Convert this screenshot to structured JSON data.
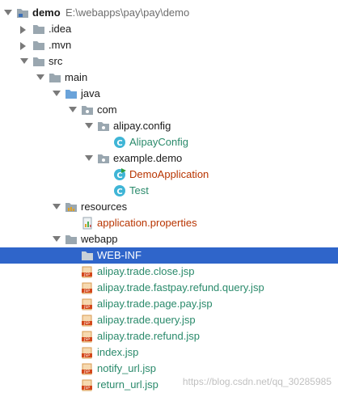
{
  "tree": [
    {
      "name": "demo",
      "path": "E:\\webapps\\pay\\pay\\demo",
      "level": 0,
      "kind": "module",
      "expanded": true,
      "bold": true
    },
    {
      "name": ".idea",
      "level": 1,
      "kind": "folder",
      "expanded": false
    },
    {
      "name": ".mvn",
      "level": 1,
      "kind": "folder",
      "expanded": false
    },
    {
      "name": "src",
      "level": 1,
      "kind": "folder",
      "expanded": true
    },
    {
      "name": "main",
      "level": 2,
      "kind": "folder",
      "expanded": true
    },
    {
      "name": "java",
      "level": 3,
      "kind": "source-folder",
      "expanded": true
    },
    {
      "name": "com",
      "level": 4,
      "kind": "package",
      "expanded": true
    },
    {
      "name": "alipay.config",
      "level": 5,
      "kind": "package",
      "expanded": true
    },
    {
      "name": "AlipayConfig",
      "level": 6,
      "kind": "class",
      "style": "link"
    },
    {
      "name": "example.demo",
      "level": 5,
      "kind": "package",
      "expanded": true
    },
    {
      "name": "DemoApplication",
      "level": 6,
      "kind": "class-run",
      "style": "red"
    },
    {
      "name": "Test",
      "level": 6,
      "kind": "class",
      "style": "link"
    },
    {
      "name": "resources",
      "level": 3,
      "kind": "resources",
      "expanded": true
    },
    {
      "name": "application.properties",
      "level": 4,
      "kind": "properties",
      "style": "red"
    },
    {
      "name": "webapp",
      "level": 3,
      "kind": "folder",
      "expanded": true
    },
    {
      "name": "WEB-INF",
      "level": 4,
      "kind": "folder-web",
      "selected": true
    },
    {
      "name": "alipay.trade.close.jsp",
      "level": 4,
      "kind": "jsp",
      "style": "link"
    },
    {
      "name": "alipay.trade.fastpay.refund.query.jsp",
      "level": 4,
      "kind": "jsp",
      "style": "link"
    },
    {
      "name": "alipay.trade.page.pay.jsp",
      "level": 4,
      "kind": "jsp",
      "style": "link"
    },
    {
      "name": "alipay.trade.query.jsp",
      "level": 4,
      "kind": "jsp",
      "style": "link"
    },
    {
      "name": "alipay.trade.refund.jsp",
      "level": 4,
      "kind": "jsp",
      "style": "link"
    },
    {
      "name": "index.jsp",
      "level": 4,
      "kind": "jsp",
      "style": "link"
    },
    {
      "name": "notify_url.jsp",
      "level": 4,
      "kind": "jsp",
      "style": "link"
    },
    {
      "name": "return_url.jsp",
      "level": 4,
      "kind": "jsp",
      "style": "link"
    }
  ],
  "watermark": "https://blog.csdn.net/qq_30285985",
  "colors": {
    "selection": "#2f65ca",
    "link_text": "#2a8a6b",
    "modified_text": "#b83400",
    "folder": "#9aa7b0",
    "source_folder": "#6aa3da",
    "class_icon": "#3fb5d6"
  }
}
